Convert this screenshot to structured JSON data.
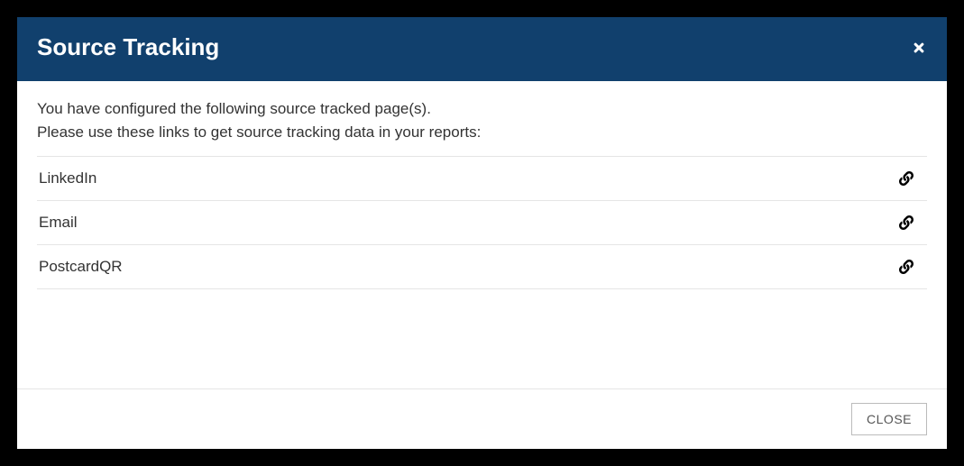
{
  "modal": {
    "title": "Source Tracking",
    "intro_line1": "You have configured the following source tracked page(s).",
    "intro_line2": "Please use these links to get source tracking data in your reports:",
    "close_button_label": "CLOSE"
  },
  "sources": [
    {
      "name": "LinkedIn"
    },
    {
      "name": "Email"
    },
    {
      "name": "PostcardQR"
    }
  ]
}
